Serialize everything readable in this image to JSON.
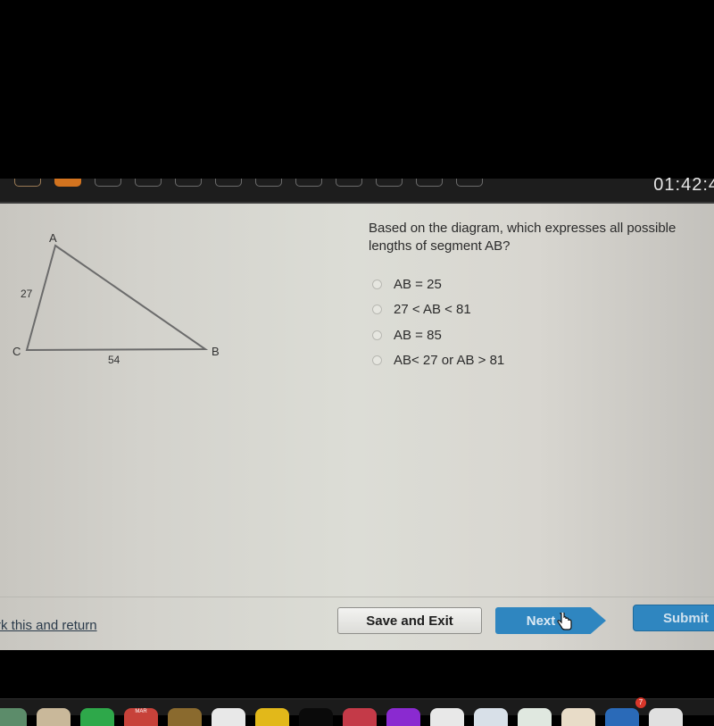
{
  "topbar": {
    "question_count": 12,
    "visited_index": 0,
    "current_index": 1,
    "timer": "01:42:4"
  },
  "diagram": {
    "vertices": {
      "A": "A",
      "B": "B",
      "C": "C"
    },
    "side_labels": {
      "AC": "27",
      "CB": "54"
    }
  },
  "question": {
    "text": "Based on the diagram, which expresses all possible lengths of segment AB?",
    "choices": [
      {
        "label": "AB = 25",
        "selected": false
      },
      {
        "label": "27 < AB < 81",
        "selected": false
      },
      {
        "label": "AB = 85",
        "selected": false
      },
      {
        "label": "AB< 27 or AB > 81",
        "selected": false
      }
    ]
  },
  "footer": {
    "mark_link": "rk this and return",
    "save_exit": "Save and Exit",
    "next": "Next",
    "submit": "Submit"
  },
  "dock": {
    "mail_label": "MAR",
    "badge_count": "7",
    "colors": [
      "#5c8c6a",
      "#c9b89a",
      "#2ea84a",
      "#c7423a",
      "#8a6a2e",
      "#e8e8e8",
      "#e2b81a",
      "#0a0a0a",
      "#c43a48",
      "#8a2ad0",
      "#e8e8e8",
      "#d8e0e8",
      "#e0e8e0",
      "#e8dcc8",
      "#2a6ab8",
      "#e0e0e0"
    ]
  },
  "colors": {
    "accent_blue": "#2f86c0",
    "current_question": "#d2731f"
  }
}
